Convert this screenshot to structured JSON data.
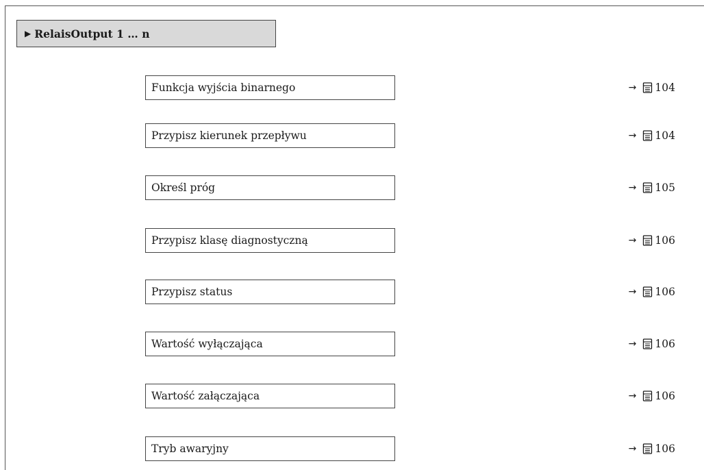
{
  "menu": {
    "title": "RelaisOutput 1 … n",
    "icon": "triangle-right-icon"
  },
  "parameters": [
    {
      "label": "Funkcja wyjścia binarnego",
      "page": "104"
    },
    {
      "label": "Przypisz kierunek przepływu",
      "page": "104"
    },
    {
      "label": "Określ próg",
      "page": "105"
    },
    {
      "label": "Przypisz klasę diagnostyczną",
      "page": "106"
    },
    {
      "label": "Przypisz status",
      "page": "106"
    },
    {
      "label": "Wartość wyłączająca",
      "page": "106"
    },
    {
      "label": "Wartość załączająca",
      "page": "106"
    },
    {
      "label": "Tryb awaryjny",
      "page": "106"
    }
  ],
  "icons": {
    "reference_arrow": "right-arrow-icon",
    "page_reference": "book-icon"
  }
}
